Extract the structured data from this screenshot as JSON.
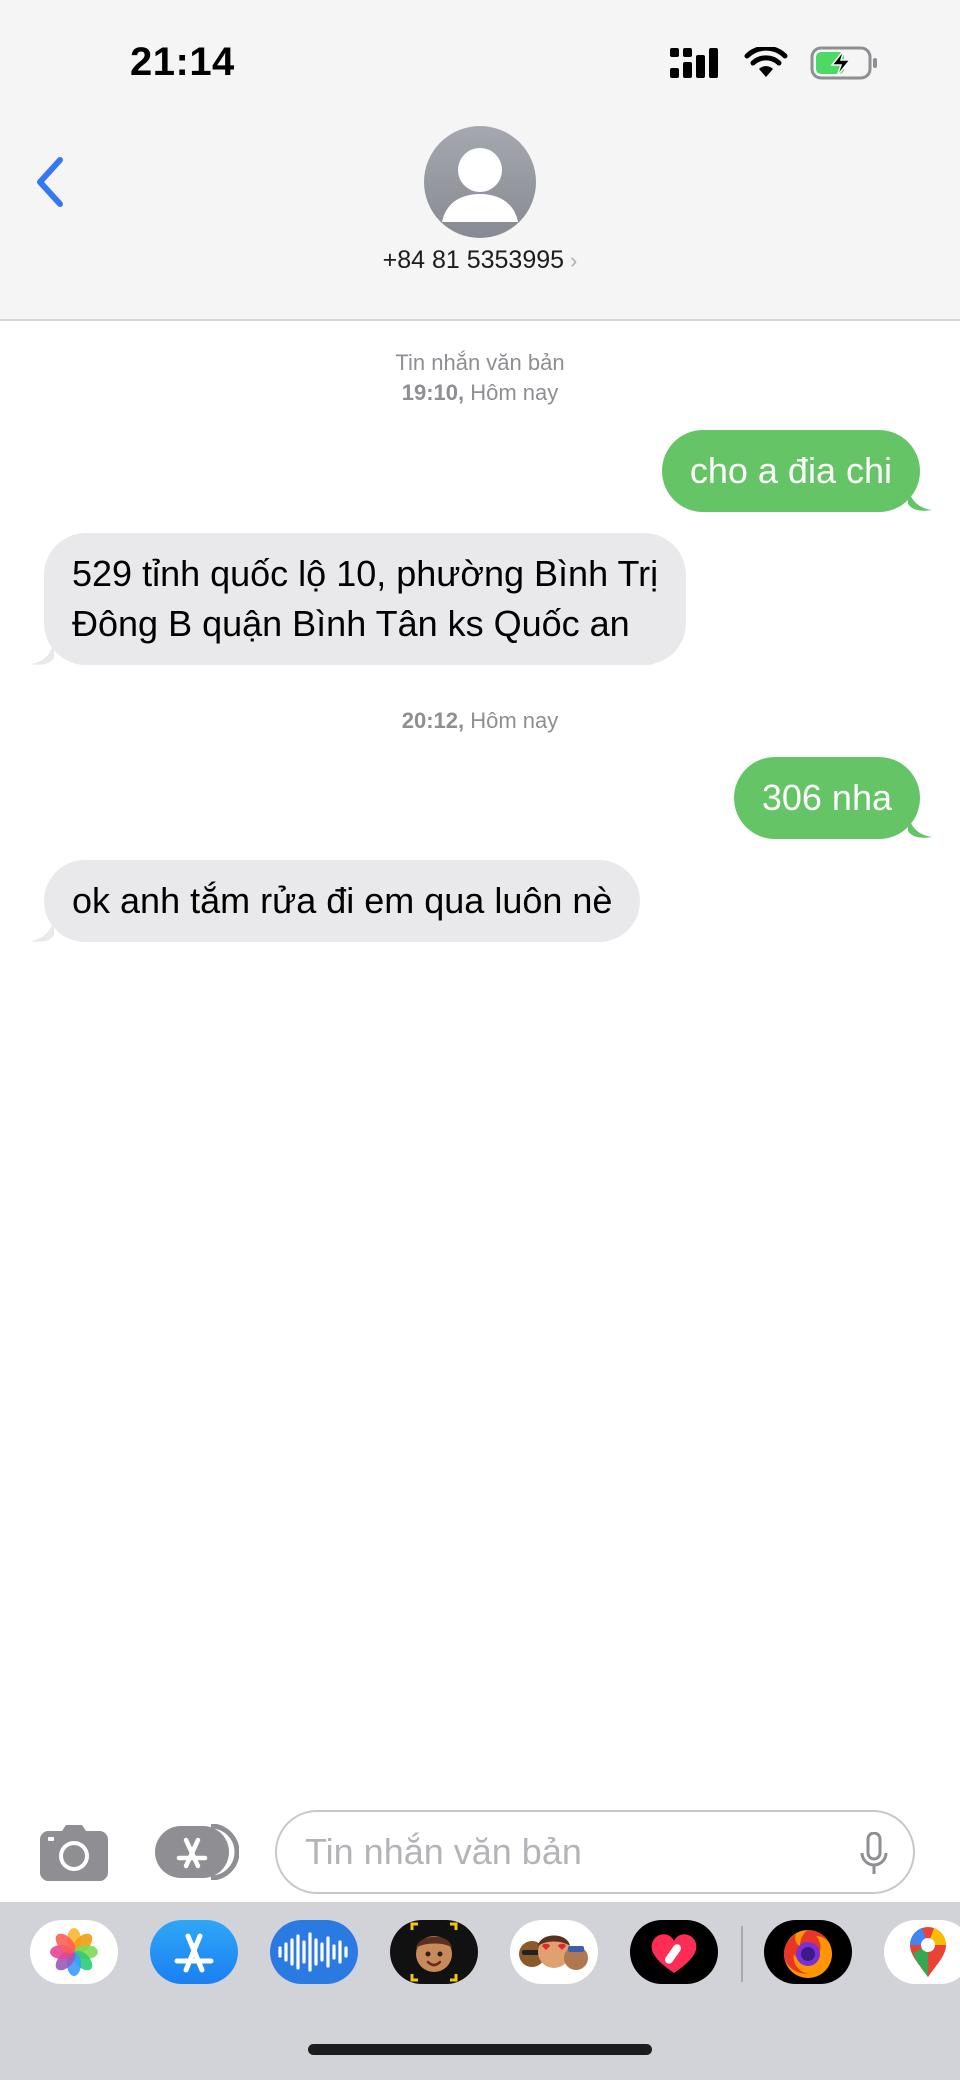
{
  "status_bar": {
    "time": "21:14",
    "battery_color": "#4cd964"
  },
  "header": {
    "contact_number": "+84 81 5353995",
    "chevron": "›",
    "accent_color": "#3478f6"
  },
  "conversation": {
    "timestamp_1": {
      "kind": "Tin nhắn văn bản",
      "time": "19:10,",
      "day": "Hôm nay"
    },
    "timestamp_2": {
      "time": "20:12,",
      "day": "Hôm nay"
    },
    "messages": [
      {
        "direction": "outgoing",
        "text": "cho a đia chi"
      },
      {
        "direction": "incoming",
        "line1": "529 tỉnh quốc lộ 10, phường Bình Trị",
        "line2": "Đông B quận Bình Tân ks Quốc an"
      },
      {
        "direction": "outgoing",
        "text": "306 nha"
      },
      {
        "direction": "incoming",
        "text": "ok anh tắm rửa đi em qua luôn nè"
      }
    ],
    "outgoing_color": "#65c466",
    "incoming_color": "#e9e9eb"
  },
  "input_bar": {
    "placeholder": "Tin nhắn văn bản"
  },
  "app_drawer": {
    "apps": [
      "photos-icon",
      "app-store-icon",
      "audio-message-icon",
      "memoji-icon",
      "animoji-stickers-icon",
      "digital-touch-icon",
      "firefox-icon",
      "google-maps-icon"
    ]
  }
}
